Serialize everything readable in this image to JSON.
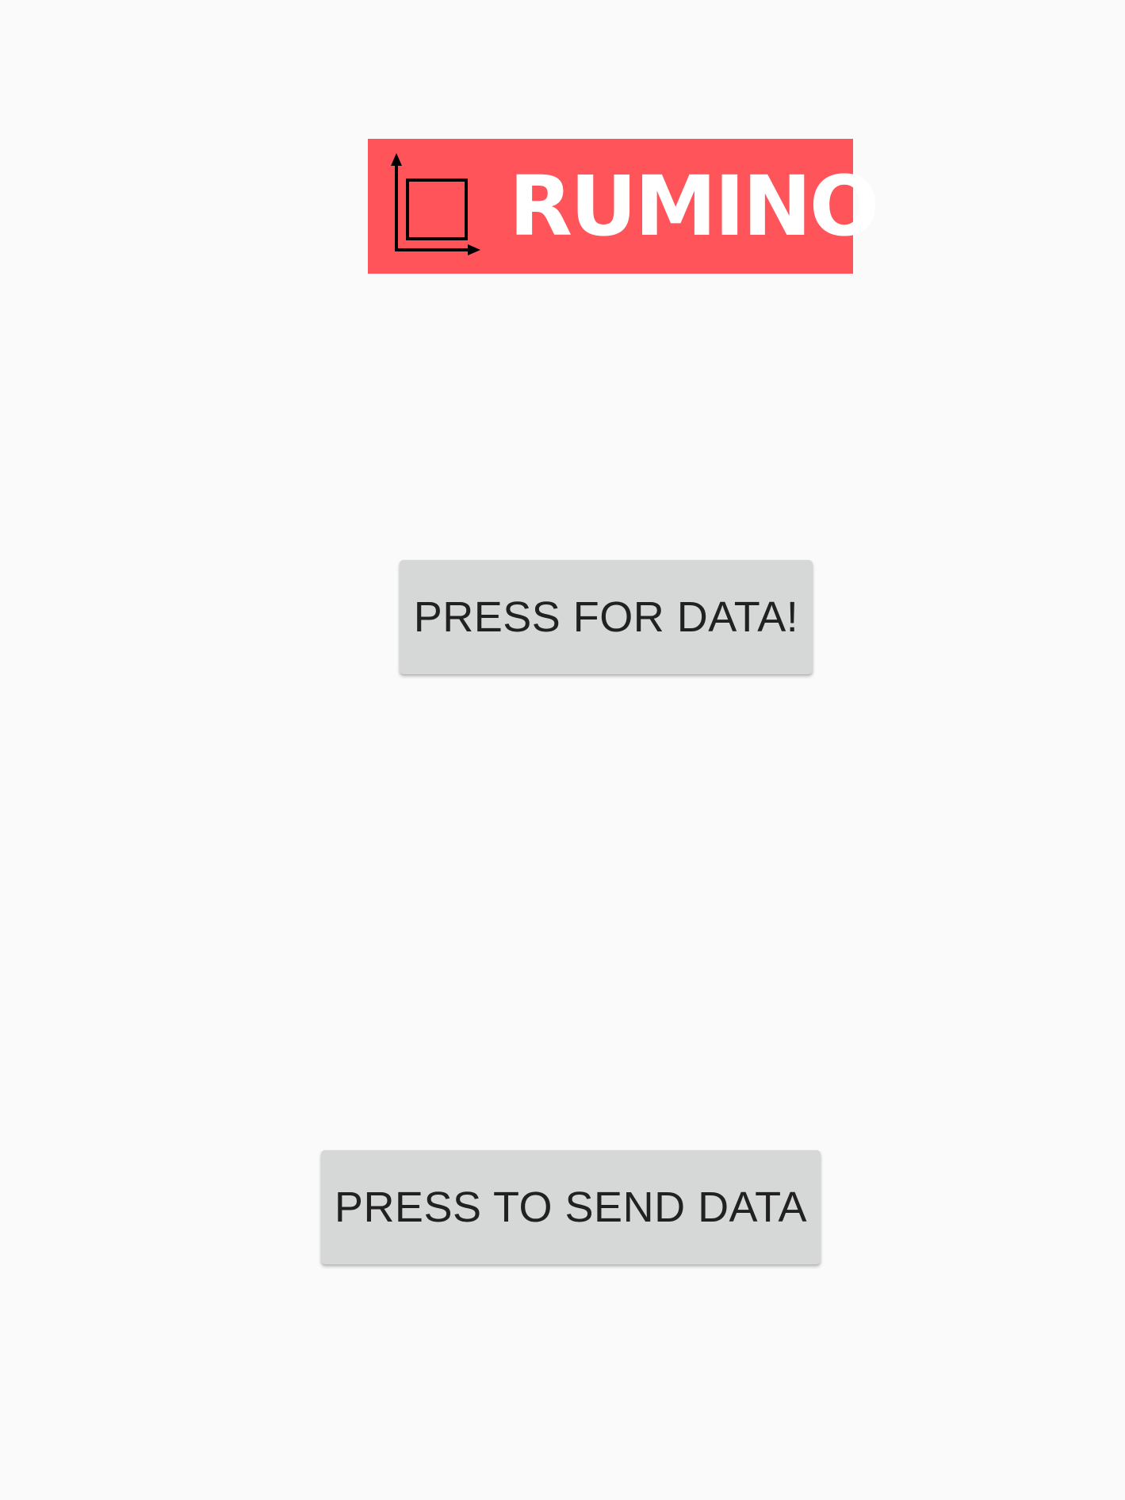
{
  "brand": {
    "logo_text": "RUMINO",
    "logo_icon": "axes-square-icon",
    "logo_bg_color": "#FF5459"
  },
  "buttons": {
    "fetch_label": "PRESS FOR DATA!",
    "send_label": "PRESS TO SEND DATA",
    "bg_color": "#D6D7D7",
    "text_color": "#212121"
  },
  "colors": {
    "background": "#FAFAFA"
  }
}
